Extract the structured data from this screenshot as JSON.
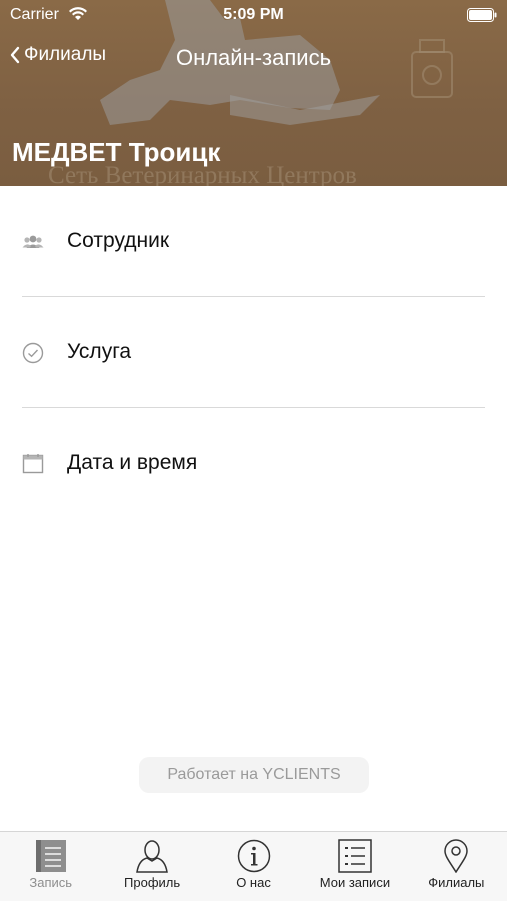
{
  "status_bar": {
    "carrier": "Carrier",
    "time": "5:09 PM"
  },
  "nav": {
    "back_label": "Филиалы",
    "title": "Онлайн-запись"
  },
  "header": {
    "branch_name": "МЕДВЕТ Троицк",
    "background_text": "Сеть Ветеринарных Центров"
  },
  "menu": {
    "items": [
      {
        "label": "Сотрудник",
        "icon": "people-icon"
      },
      {
        "label": "Услуга",
        "icon": "checkmark-circle-icon"
      },
      {
        "label": "Дата и время",
        "icon": "calendar-icon"
      }
    ]
  },
  "powered_by": "Работает на YCLIENTS",
  "tabbar": {
    "tabs": [
      {
        "label": "Запись",
        "icon": "book-icon",
        "active": true
      },
      {
        "label": "Профиль",
        "icon": "person-icon",
        "active": false
      },
      {
        "label": "О нас",
        "icon": "info-icon",
        "active": false
      },
      {
        "label": "Мои записи",
        "icon": "list-icon",
        "active": false
      },
      {
        "label": "Филиалы",
        "icon": "location-pin-icon",
        "active": false
      }
    ]
  },
  "colors": {
    "header_bg": "#7f6143",
    "text": "#111111",
    "separator": "#d9d9d9",
    "tab_inactive": "#222222",
    "tab_active": "#8e8e8e"
  }
}
